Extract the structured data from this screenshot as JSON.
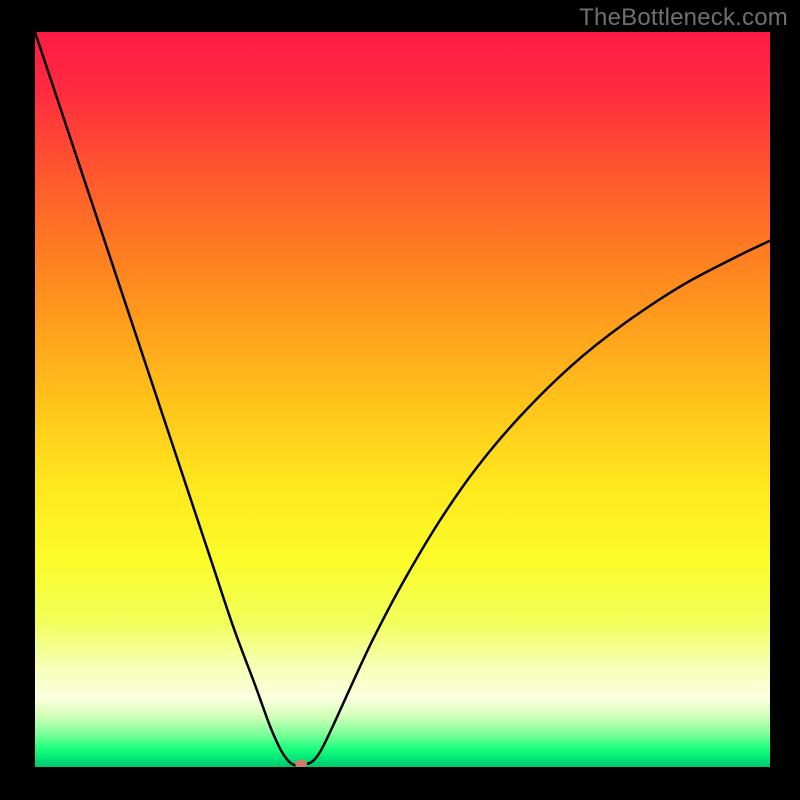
{
  "watermark": "TheBottleneck.com",
  "chart_data": {
    "type": "line",
    "title": "",
    "xlabel": "",
    "ylabel": "",
    "xlim": [
      0,
      100
    ],
    "ylim": [
      0,
      100
    ],
    "background_gradient": {
      "stops": [
        {
          "offset": 0.0,
          "color": "#ff1a46"
        },
        {
          "offset": 0.08,
          "color": "#ff2b40"
        },
        {
          "offset": 0.2,
          "color": "#ff5a2c"
        },
        {
          "offset": 0.35,
          "color": "#ff8e1e"
        },
        {
          "offset": 0.5,
          "color": "#ffc21a"
        },
        {
          "offset": 0.62,
          "color": "#ffe81e"
        },
        {
          "offset": 0.72,
          "color": "#fcfc2a"
        },
        {
          "offset": 0.8,
          "color": "#f2ff58"
        },
        {
          "offset": 0.86,
          "color": "#f6ffb0"
        },
        {
          "offset": 0.905,
          "color": "#fbffdf"
        },
        {
          "offset": 0.93,
          "color": "#d4ffb8"
        },
        {
          "offset": 0.955,
          "color": "#7cff9a"
        },
        {
          "offset": 0.975,
          "color": "#1bff7e"
        },
        {
          "offset": 0.99,
          "color": "#00e277"
        },
        {
          "offset": 1.0,
          "color": "#00c76a"
        }
      ]
    },
    "series": [
      {
        "name": "bottleneck-curve",
        "color": "#000000",
        "width": 2.5,
        "x": [
          0,
          3,
          6,
          9,
          12,
          15,
          18,
          21,
          24,
          27,
          30,
          32,
          33.5,
          34.5,
          35.2,
          36,
          37.5,
          38.5,
          39.5,
          41,
          43,
          46,
          50,
          55,
          60,
          66,
          73,
          80,
          88,
          95,
          100
        ],
        "y": [
          100,
          91,
          82,
          73,
          64,
          55,
          46,
          37,
          28,
          19,
          11,
          5.5,
          2.2,
          0.8,
          0.3,
          0.3,
          0.6,
          1.6,
          3.4,
          6.6,
          11,
          17.4,
          25,
          33.4,
          40.6,
          47.7,
          54.6,
          60.2,
          65.5,
          69.2,
          71.6
        ]
      }
    ],
    "marker": {
      "name": "optimal-point",
      "x": 36.2,
      "y": 0.4,
      "rx": 6,
      "ry": 4.5,
      "color": "#cf7b6c"
    }
  }
}
